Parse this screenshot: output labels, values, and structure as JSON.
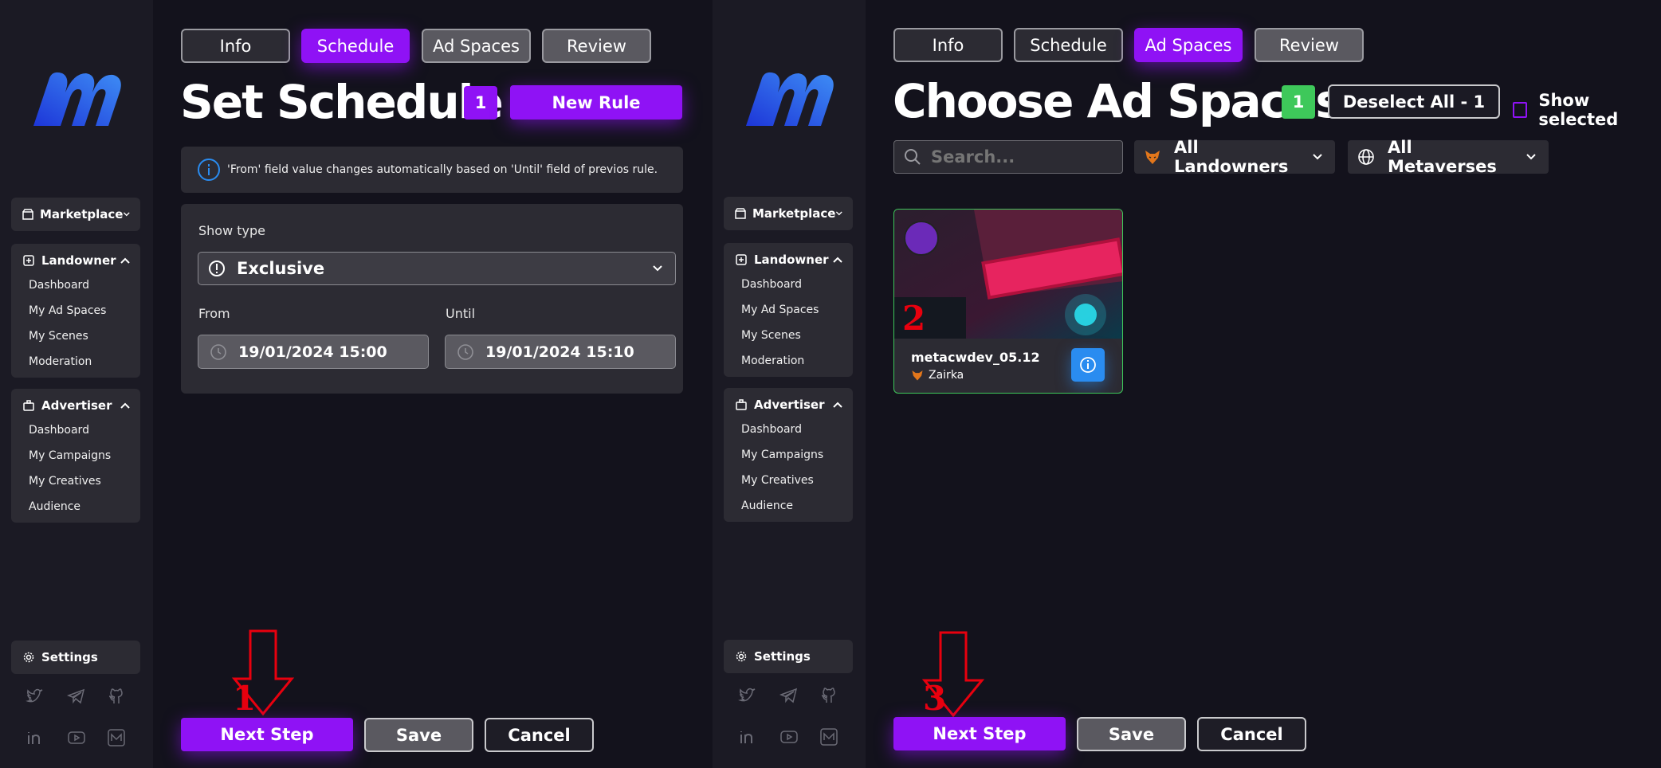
{
  "left": {
    "sidebar": {
      "marketplace": "Marketplace",
      "landowner": "Landowner",
      "landowner_items": [
        "Dashboard",
        "My Ad Spaces",
        "My Scenes",
        "Moderation"
      ],
      "advertiser": "Advertiser",
      "advertiser_items": [
        "Dashboard",
        "My Campaigns",
        "My Creatives",
        "Audience"
      ],
      "settings": "Settings"
    },
    "tabs": [
      "Info",
      "Schedule",
      "Ad Spaces",
      "Review"
    ],
    "active_tab": "Schedule",
    "title": "Set Schedule",
    "rule_count": "1",
    "new_rule": "New Rule",
    "info_text": "'From' field value changes automatically based on 'Until' field of previos rule.",
    "show_type_label": "Show type",
    "show_type_value": "Exclusive",
    "from_label": "From",
    "from_value": "19/01/2024 15:00",
    "until_label": "Until",
    "until_value": "19/01/2024 15:10",
    "next_step": "Next Step",
    "save": "Save",
    "cancel": "Cancel",
    "annotation": "1"
  },
  "right": {
    "sidebar": {
      "marketplace": "Marketplace",
      "landowner": "Landowner",
      "landowner_items": [
        "Dashboard",
        "My Ad Spaces",
        "My Scenes",
        "Moderation"
      ],
      "advertiser": "Advertiser",
      "advertiser_items": [
        "Dashboard",
        "My Campaigns",
        "My Creatives",
        "Audience"
      ],
      "settings": "Settings"
    },
    "tabs": [
      "Info",
      "Schedule",
      "Ad Spaces",
      "Review"
    ],
    "active_tab": "Ad Spaces",
    "title": "Choose Ad Spaces",
    "selected_count": "1",
    "deselect_all": "Deselect All - 1",
    "show_selected": "Show selected",
    "search_placeholder": "Search...",
    "landowners_filter": "All Landowners",
    "metaverses_filter": "All Metaverses",
    "ad_space": {
      "name": "metacwdev_05.12",
      "owner": "Zairka"
    },
    "next_step": "Next Step",
    "save": "Save",
    "cancel": "Cancel",
    "annotation_card": "2",
    "annotation": "3"
  },
  "colors": {
    "accent_purple": "#8f12f5",
    "success_green": "#3ec85a",
    "info_blue": "#2a8cf0",
    "annotation_red": "#e8000e"
  }
}
